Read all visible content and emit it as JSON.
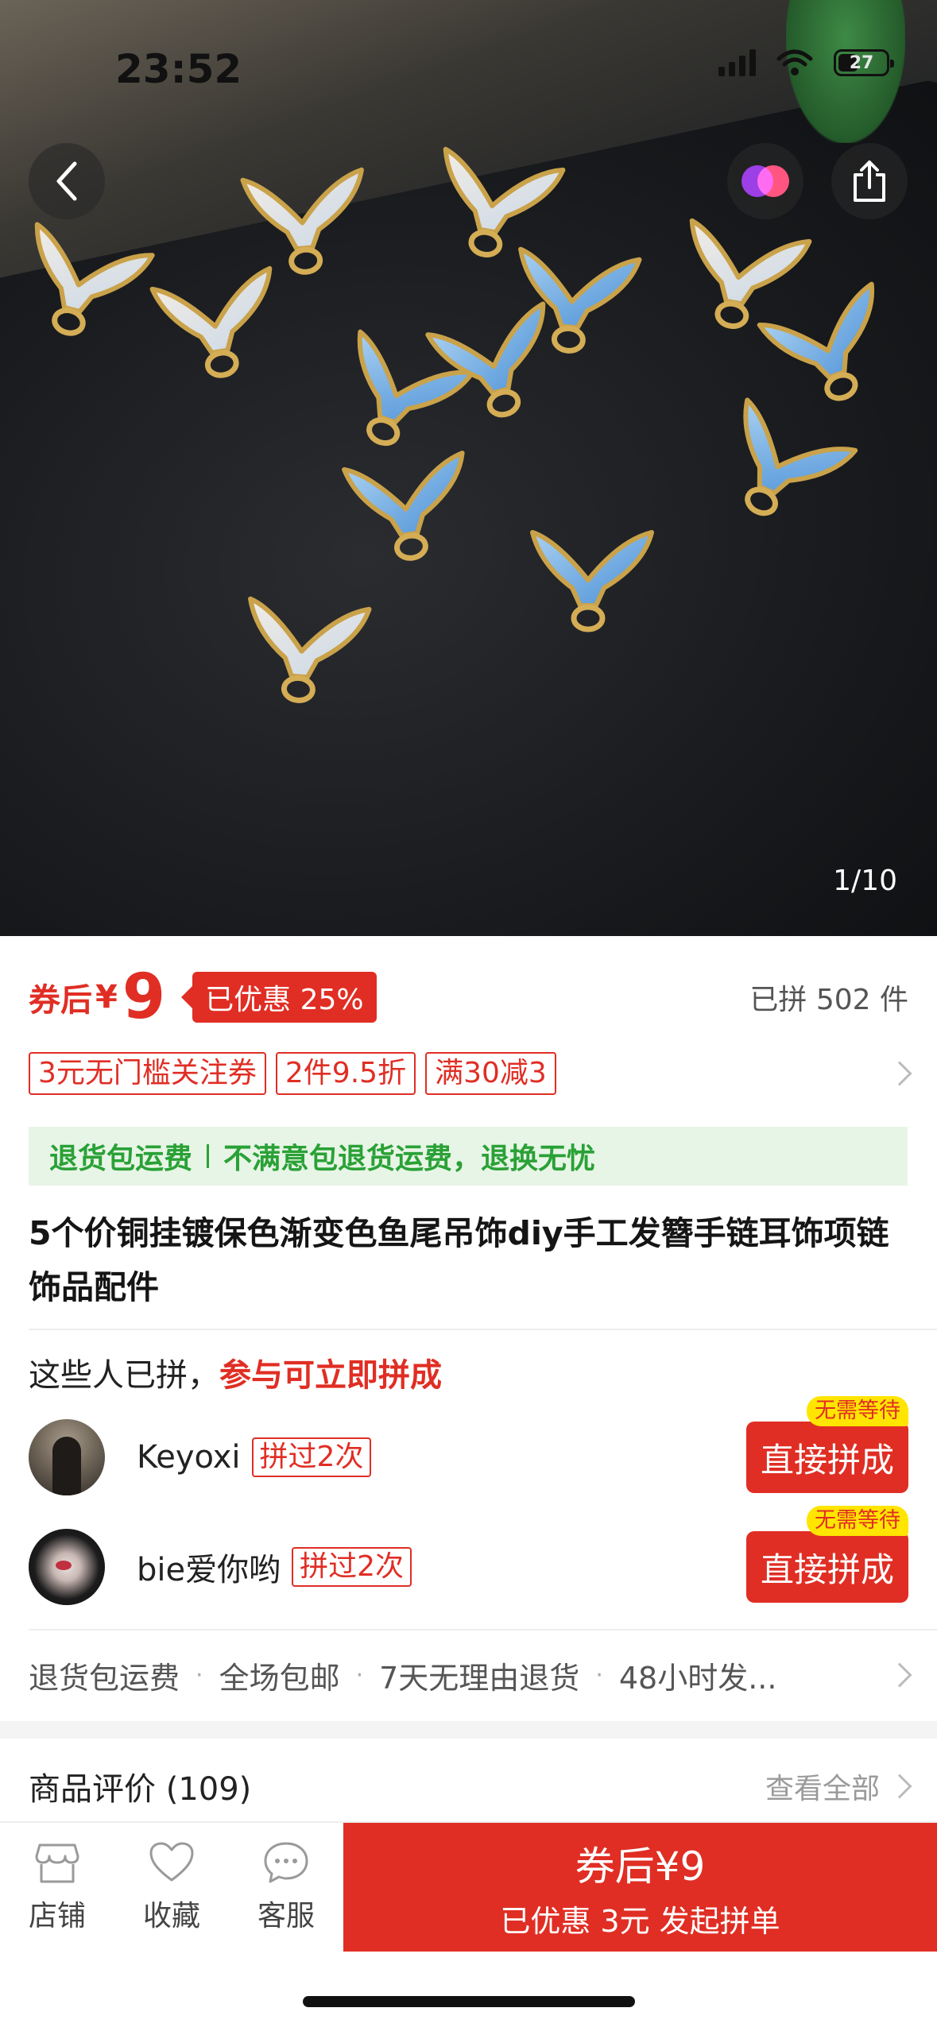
{
  "status_bar": {
    "time": "23:52",
    "battery": "27"
  },
  "gallery": {
    "counter": "1/10"
  },
  "price": {
    "prefix": "券后",
    "currency": "¥",
    "amount": "9",
    "discount_tag": "已优惠 25%",
    "sold": "已拼 502 件"
  },
  "promos": [
    "3元无门槛关注券",
    "2件9.5折",
    "满30减3"
  ],
  "guarantee": {
    "title": "退货包运费",
    "desc": "不满意包退货运费，退换无忧"
  },
  "product_title": "5个价铜挂镀保色渐变色鱼尾吊饰diy手工发簪手链耳饰项链饰品配件",
  "group": {
    "heading": "这些人已拼，",
    "heading_red": "参与可立即拼成",
    "buyers": [
      {
        "name": "Keyoxi",
        "tried": "拼过2次",
        "badge": "无需等待",
        "button": "直接拼成"
      },
      {
        "name": "bie爱你哟",
        "tried": "拼过2次",
        "badge": "无需等待",
        "button": "直接拼成"
      }
    ]
  },
  "services": [
    "退货包运费",
    "全场包邮",
    "7天无理由退货",
    "48小时发..."
  ],
  "reviews": {
    "label": "商品评价 (109)",
    "more": "查看全部"
  },
  "bottom_bar": {
    "shop": "店铺",
    "favorite": "收藏",
    "service": "客服",
    "buy_line1": "券后¥9",
    "buy_line2": "已优惠 3元 发起拼单"
  },
  "colors": {
    "accent": "#e02e24",
    "guarantee_green": "#2aa136",
    "badge_yellow": "#ffe500"
  }
}
